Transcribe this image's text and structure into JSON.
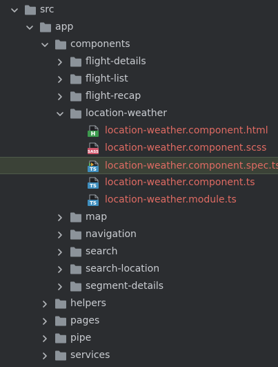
{
  "tree": [
    {
      "label": "src",
      "type": "folder",
      "depth": 0,
      "expanded": true
    },
    {
      "label": "app",
      "type": "folder",
      "depth": 1,
      "expanded": true
    },
    {
      "label": "components",
      "type": "folder",
      "depth": 2,
      "expanded": true
    },
    {
      "label": "flight-details",
      "type": "folder",
      "depth": 3,
      "expanded": false
    },
    {
      "label": "flight-list",
      "type": "folder",
      "depth": 3,
      "expanded": false
    },
    {
      "label": "flight-recap",
      "type": "folder",
      "depth": 3,
      "expanded": false
    },
    {
      "label": "location-weather",
      "type": "folder",
      "depth": 3,
      "expanded": true
    },
    {
      "label": "location-weather.component.html",
      "type": "html",
      "depth": 4,
      "modified": true
    },
    {
      "label": "location-weather.component.scss",
      "type": "sass",
      "depth": 4,
      "modified": true
    },
    {
      "label": "location-weather.component.spec.ts",
      "type": "spec",
      "depth": 4,
      "modified": true,
      "selected": true
    },
    {
      "label": "location-weather.component.ts",
      "type": "ts",
      "depth": 4,
      "modified": true
    },
    {
      "label": "location-weather.module.ts",
      "type": "ts",
      "depth": 4,
      "modified": true
    },
    {
      "label": "map",
      "type": "folder",
      "depth": 3,
      "expanded": false
    },
    {
      "label": "navigation",
      "type": "folder",
      "depth": 3,
      "expanded": false
    },
    {
      "label": "search",
      "type": "folder",
      "depth": 3,
      "expanded": false
    },
    {
      "label": "search-location",
      "type": "folder",
      "depth": 3,
      "expanded": false
    },
    {
      "label": "segment-details",
      "type": "folder",
      "depth": 3,
      "expanded": false
    },
    {
      "label": "helpers",
      "type": "folder",
      "depth": 2,
      "expanded": false
    },
    {
      "label": "pages",
      "type": "folder",
      "depth": 2,
      "expanded": false
    },
    {
      "label": "pipe",
      "type": "folder",
      "depth": 2,
      "expanded": false
    },
    {
      "label": "services",
      "type": "folder",
      "depth": 2,
      "expanded": false
    }
  ],
  "badges": {
    "html": "H",
    "sass": "SASS",
    "ts": "TS"
  },
  "colors": {
    "background": "#2b2d30",
    "text": "#c9ccd1",
    "modified_text": "#df6b63",
    "folder": "#8c939a",
    "chevron": "#b3b6ba",
    "selection": "#3b4237",
    "html_badge": "#3d9a4e",
    "sass_badge": "#d1566b",
    "ts_badge": "#3f8fbf"
  }
}
